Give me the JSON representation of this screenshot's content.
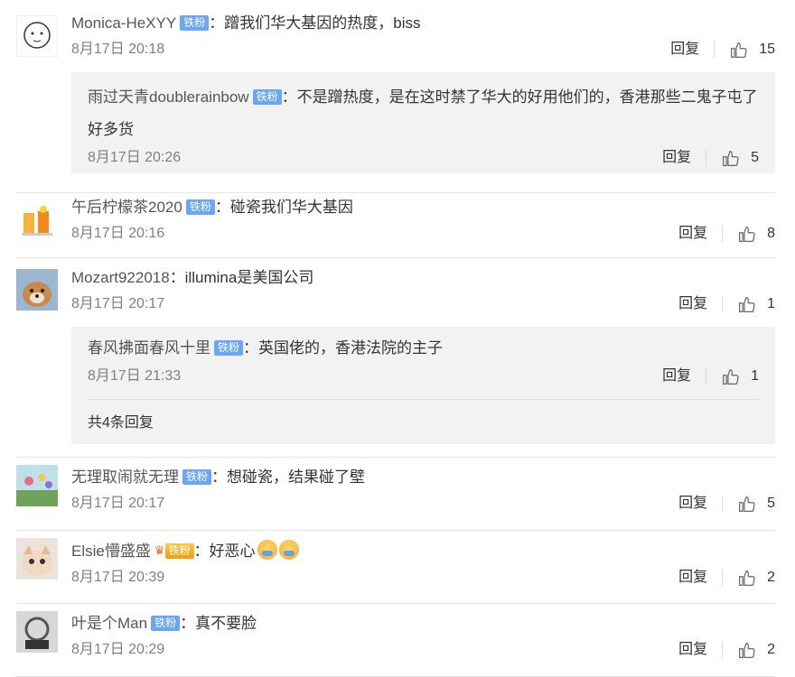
{
  "comments": [
    {
      "username": "Monica-HeXYY",
      "badge": "铁粉",
      "text": "：蹭我们华大基因的热度，biss",
      "time": "8月17日 20:18",
      "reply": "回复",
      "likes": "15",
      "sub": {
        "username": "雨过天青doublerainbow",
        "badge": "铁粉",
        "text": "：不是蹭热度，是在这时禁了华大的好用他们的，香港那些二鬼子屯了好多货",
        "time": "8月17日 20:26",
        "reply": "回复",
        "likes": "5"
      }
    },
    {
      "username": "午后柠檬茶2020",
      "badge": "铁粉",
      "text": "：碰瓷我们华大基因",
      "time": "8月17日 20:16",
      "reply": "回复",
      "likes": "8"
    },
    {
      "username": "Mozart922018",
      "text": "：illumina是美国公司",
      "time": "8月17日 20:17",
      "reply": "回复",
      "likes": "1",
      "sub": {
        "username": "春风拂面春风十里",
        "badge": "铁粉",
        "text": "：英国佬的，香港法院的主子",
        "time": "8月17日 21:33",
        "reply": "回复",
        "likes": "1",
        "more": "共4条回复"
      }
    },
    {
      "username": "无理取闹就无理",
      "badge": "铁粉",
      "text": "：想碰瓷，结果碰了壁",
      "time": "8月17日 20:17",
      "reply": "回复",
      "likes": "5"
    },
    {
      "username": "Elsie懵盛盛",
      "badge": "铁粉",
      "badge_style": "gold",
      "text": "：好恶心",
      "time": "8月17日 20:39",
      "reply": "回复",
      "likes": "2"
    },
    {
      "username": "叶是个Man",
      "badge": "铁粉",
      "text": "：真不要脸",
      "time": "8月17日 20:29",
      "reply": "回复",
      "likes": "2"
    }
  ],
  "colors": {
    "badge": "#69a7f5",
    "badge_gold": "#f39b10",
    "sub_bg": "#f2f2f2"
  }
}
